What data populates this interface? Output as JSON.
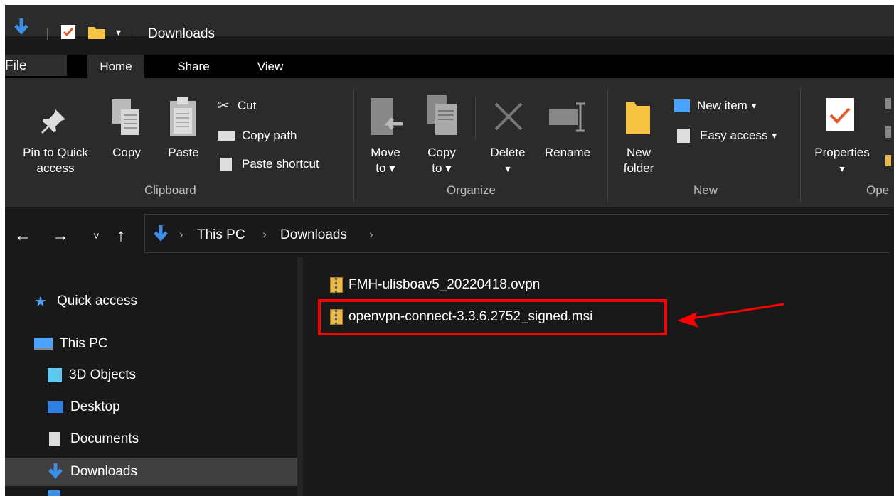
{
  "window": {
    "title": "Downloads"
  },
  "tabs": [
    {
      "label": "File"
    },
    {
      "label": "Home"
    },
    {
      "label": "Share"
    },
    {
      "label": "View"
    }
  ],
  "ribbon": {
    "clipboard": {
      "pin": "Pin to Quick access",
      "pin_l1": "Pin to Quick",
      "pin_l2": "access",
      "copy": "Copy",
      "paste": "Paste",
      "cut": "Cut",
      "copy_path": "Copy path",
      "paste_shortcut": "Paste shortcut",
      "group": "Clipboard"
    },
    "organize": {
      "move_l1": "Move",
      "move_l2": "to",
      "copy_l1": "Copy",
      "copy_l2": "to",
      "delete": "Delete",
      "rename": "Rename",
      "group": "Organize"
    },
    "new": {
      "new_l1": "New",
      "new_l2": "folder",
      "new_item": "New item",
      "easy_access": "Easy access",
      "group": "New"
    },
    "open": {
      "properties": "Properties",
      "group": "Ope"
    }
  },
  "address": {
    "crumbs": [
      {
        "label": "This PC"
      },
      {
        "label": "Downloads"
      }
    ]
  },
  "nav": {
    "items": [
      {
        "label": "Quick access",
        "icon": "star-icon"
      },
      {
        "label": "This PC",
        "icon": "monitor-icon"
      },
      {
        "label": "3D Objects",
        "icon": "cube-icon"
      },
      {
        "label": "Desktop",
        "icon": "desktop-icon"
      },
      {
        "label": "Documents",
        "icon": "document-icon"
      },
      {
        "label": "Downloads",
        "icon": "download-arrow-icon"
      }
    ]
  },
  "files": [
    {
      "name": "FMH-ulisboav5_20220418.ovpn"
    },
    {
      "name": "openvpn-connect-3.3.6.2752_signed.msi"
    }
  ],
  "colors": {
    "accent": "#3c8ee6",
    "folder": "#f5c542",
    "highlight": "#ff0000"
  }
}
